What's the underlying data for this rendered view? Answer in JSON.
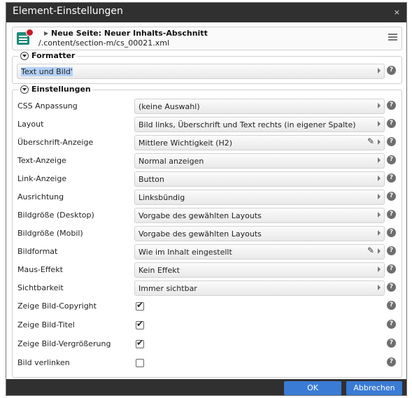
{
  "window": {
    "title": "Element-Einstellungen",
    "close_glyph": "×"
  },
  "header": {
    "title": "Neue Seite: Neuer Inhalts-Abschnitt",
    "path": "/.content/section-m/cs_00021.xml",
    "icon": "content-section-icon",
    "status_dot_color": "#c8192b"
  },
  "formatter": {
    "legend": "Formatter",
    "value": "Text und Bild'"
  },
  "settings": {
    "legend": "Einstellungen",
    "rows": [
      {
        "label": "CSS Anpassung",
        "type": "select",
        "value": "(keine Auswahl)"
      },
      {
        "label": "Layout",
        "type": "select",
        "value": "Bild links, Überschrift und Text rechts (in eigener Spalte)"
      },
      {
        "label": "Überschrift-Anzeige",
        "type": "select",
        "value": "Mittlere Wichtigkeit (H2)",
        "editable": true
      },
      {
        "label": "Text-Anzeige",
        "type": "select",
        "value": "Normal anzeigen"
      },
      {
        "label": "Link-Anzeige",
        "type": "select",
        "value": "Button"
      },
      {
        "label": "Ausrichtung",
        "type": "select",
        "value": "Linksbündig"
      },
      {
        "label": "Bildgröße (Desktop)",
        "type": "select",
        "value": "Vorgabe des gewählten Layouts"
      },
      {
        "label": "Bildgröße (Mobil)",
        "type": "select",
        "value": "Vorgabe des gewählten Layouts"
      },
      {
        "label": "Bildformat",
        "type": "select",
        "value": "Wie im Inhalt eingestellt",
        "editable": true
      },
      {
        "label": "Maus-Effekt",
        "type": "select",
        "value": "Kein Effekt"
      },
      {
        "label": "Sichtbarkeit",
        "type": "select",
        "value": "Immer sichtbar"
      },
      {
        "label": "Zeige Bild-Copyright",
        "type": "checkbox",
        "checked": true
      },
      {
        "label": "Zeige Bild-Titel",
        "type": "checkbox",
        "checked": true
      },
      {
        "label": "Zeige Bild-Vergrößerung",
        "type": "checkbox",
        "checked": true
      },
      {
        "label": "Bild verlinken",
        "type": "checkbox",
        "checked": false
      }
    ]
  },
  "footer": {
    "ok_label": "OK",
    "cancel_label": "Abbrechen"
  },
  "colors": {
    "titlebar": "#303030",
    "button": "#3a7bd5",
    "selection": "#b3d0f7"
  }
}
